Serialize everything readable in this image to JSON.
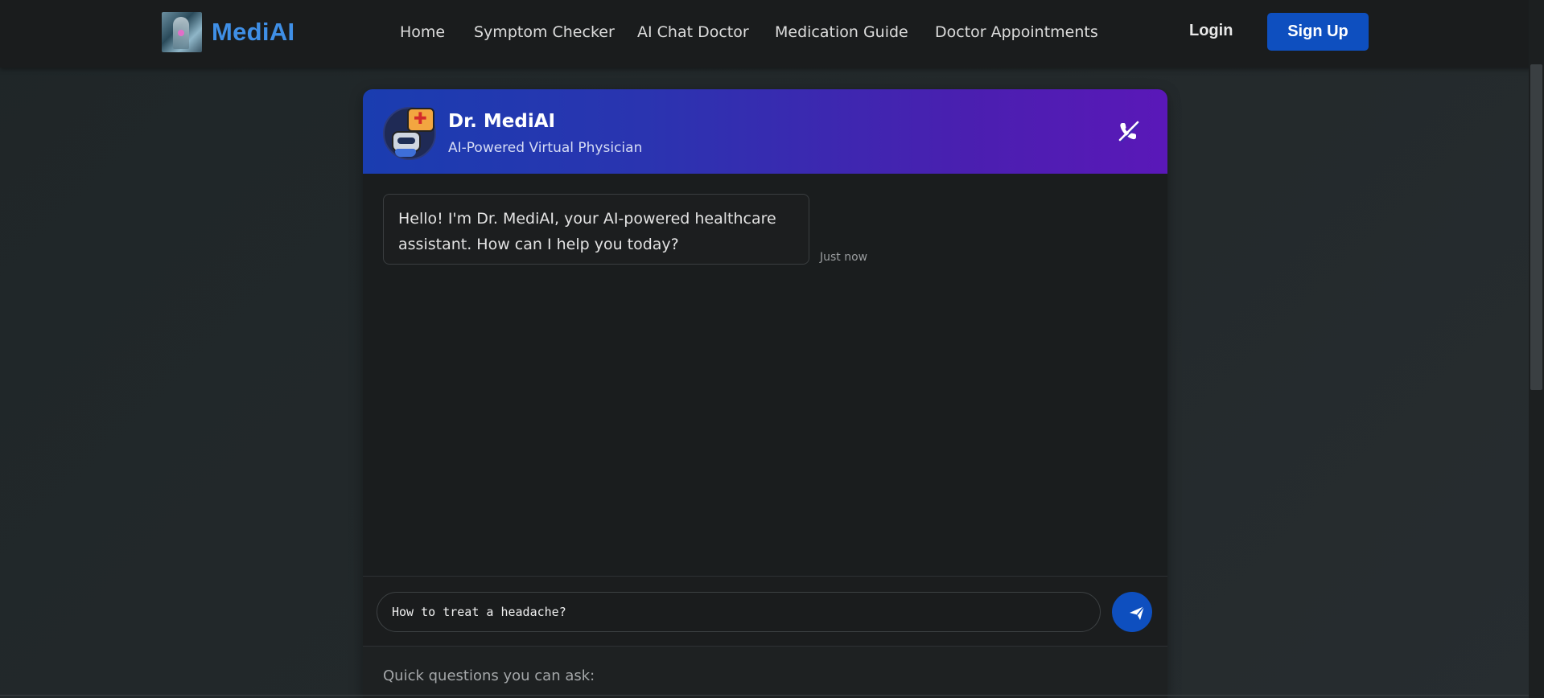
{
  "brand": {
    "name": "MediAI",
    "logo_icon": "clinician-photo-icon",
    "accent_color": "#3f8fe6"
  },
  "nav": {
    "links": [
      {
        "label": "Home"
      },
      {
        "label": "Symptom Checker"
      },
      {
        "label": "AI Chat Doctor"
      },
      {
        "label": "Medication Guide"
      },
      {
        "label": "Doctor Appointments"
      }
    ],
    "login_label": "Login",
    "signup_label": "Sign Up",
    "signup_color": "#0e4fbf"
  },
  "chat": {
    "header": {
      "name": "Dr. MediAI",
      "subtitle": "AI-Powered Virtual Physician",
      "avatar_icon": "robot-doctor-icon",
      "end_call_icon": "phone-slash-icon",
      "gradient_start": "#1a3db0",
      "gradient_end": "#5a18b8"
    },
    "messages": [
      {
        "sender": "bot",
        "text": "Hello! I'm Dr. MediAI, your AI-powered healthcare assistant. How can I help you today?",
        "time": "Just now"
      }
    ],
    "input": {
      "value": "How to treat a headache?",
      "send_icon": "paper-plane-icon"
    },
    "quick_questions": {
      "label": "Quick questions you can ask:"
    }
  }
}
